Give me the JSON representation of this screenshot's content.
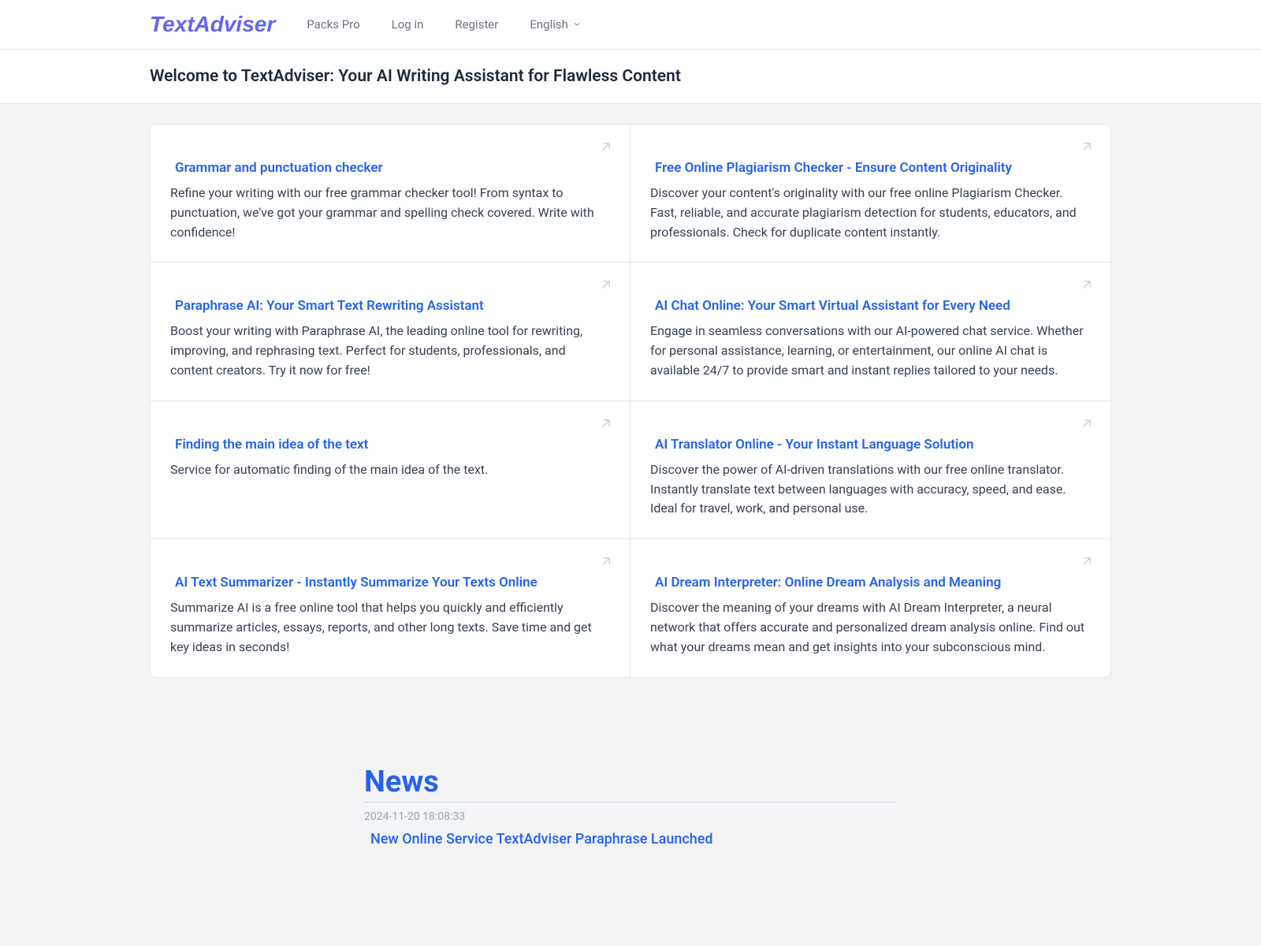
{
  "header": {
    "logo": "TextAdviser",
    "nav": {
      "packs_pro": "Packs Pro",
      "log_in": "Log in",
      "register": "Register",
      "language": "English"
    }
  },
  "welcome": {
    "title": "Welcome to TextAdviser: Your AI Writing Assistant for Flawless Content"
  },
  "cards": [
    {
      "title": "Grammar and punctuation checker",
      "desc": "Refine your writing with our free grammar checker tool! From syntax to punctuation, we've got your grammar and spelling check covered. Write with confidence!"
    },
    {
      "title": "Free Online Plagiarism Checker - Ensure Content Originality",
      "desc": "Discover your content's originality with our free online Plagiarism Checker. Fast, reliable, and accurate plagiarism detection for students, educators, and professionals. Check for duplicate content instantly."
    },
    {
      "title": "Paraphrase AI: Your Smart Text Rewriting Assistant",
      "desc": "Boost your writing with Paraphrase AI, the leading online tool for rewriting, improving, and rephrasing text. Perfect for students, professionals, and content creators. Try it now for free!"
    },
    {
      "title": "AI Chat Online: Your Smart Virtual Assistant for Every Need",
      "desc": "Engage in seamless conversations with our AI-powered chat service. Whether for personal assistance, learning, or entertainment, our online AI chat is available 24/7 to provide smart and instant replies tailored to your needs."
    },
    {
      "title": "Finding the main idea of the text",
      "desc": "Service for automatic finding of the main idea of the text."
    },
    {
      "title": "AI Translator Online - Your Instant Language Solution",
      "desc": "Discover the power of AI-driven translations with our free online translator. Instantly translate text between languages with accuracy, speed, and ease. Ideal for travel, work, and personal use."
    },
    {
      "title": "AI Text Summarizer - Instantly Summarize Your Texts Online",
      "desc": "Summarize AI is a free online tool that helps you quickly and efficiently summarize articles, essays, reports, and other long texts. Save time and get key ideas in seconds!"
    },
    {
      "title": "AI Dream Interpreter: Online Dream Analysis and Meaning",
      "desc": "Discover the meaning of your dreams with AI Dream Interpreter, a neural network that offers accurate and personalized dream analysis online. Find out what your dreams mean and get insights into your subconscious mind."
    }
  ],
  "news": {
    "heading": "News",
    "items": [
      {
        "date": "2024-11-20 18:08:33",
        "title": "New Online Service TextAdviser Paraphrase Launched"
      }
    ]
  }
}
